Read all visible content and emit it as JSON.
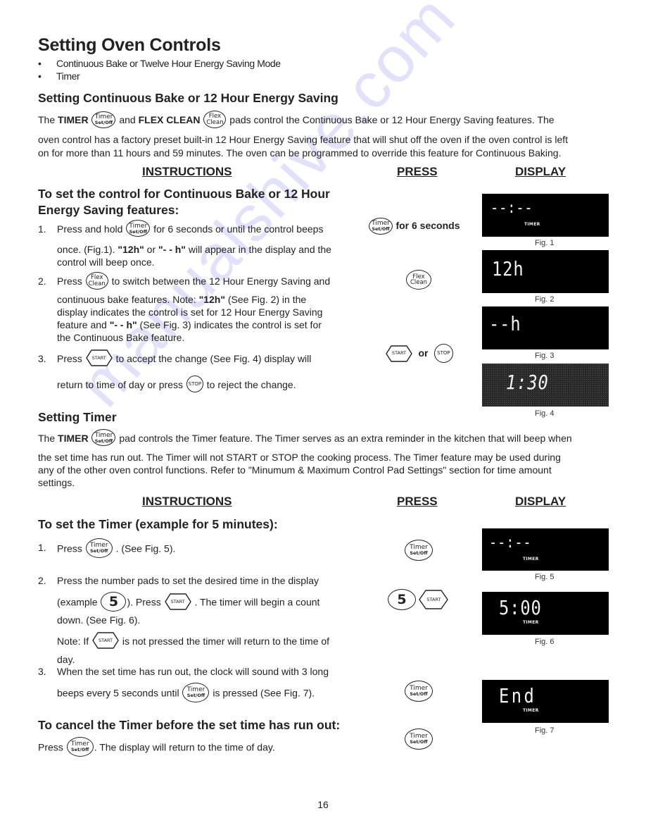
{
  "page": {
    "title": "Setting Oven Controls",
    "bullets": [
      "Continuous Bake or Twelve Hour Energy Saving Mode",
      "Timer"
    ],
    "page_number": "16",
    "watermark": "manualshive.com"
  },
  "pads": {
    "timer": {
      "line1": "Timer",
      "line2": "Set/Off"
    },
    "flex_clean": {
      "line1": "Flex",
      "line2": "Clean"
    },
    "start": "START",
    "stop": "STOP",
    "five": "5"
  },
  "columns": {
    "instructions": "INSTRUCTIONS",
    "press": "PRESS",
    "display": "DISPLAY"
  },
  "section1": {
    "heading": "Setting Continuous Bake or 12 Hour Energy Saving",
    "intro": {
      "p1_a": "The ",
      "p1_timer": "TIMER",
      "p1_b": " and ",
      "p1_flex": "FLEX CLEAN",
      "p1_c": " pads control the Continuous Bake or 12 Hour Energy Saving features. The",
      "line2": "oven control has a factory preset built-in 12 Hour Energy Saving feature that will shut off the oven if the oven control is left",
      "line3": "on for more than 11 hours and 59 minutes. The oven can be programmed to override this feature for Continuous Baking."
    },
    "subheading": "To set the control for Continuous Bake or 12 Hour Energy Saving features:",
    "steps": [
      {
        "num": "1.",
        "a": "Press and hold ",
        "b": " for 6 seconds or until the control beeps",
        "c1": "once.  (Fig.1). ",
        "c_b1": "\"12h\"",
        "c2": " or ",
        "c_b2": "\"- - h\"",
        "c3": "  will appear in the display and the",
        "d": "control will beep once."
      },
      {
        "num": "2.",
        "a": "Press ",
        "b": " to switch between the 12 Hour Energy Saving and",
        "c1": "continuous bake features. Note: ",
        "c_b1": "\"12h\"",
        "c2": " (See Fig. 2) in the",
        "d": "display indicates the control is set for 12 Hour Energy Saving",
        "e1": "feature and ",
        "e_b1": "\"- - h\"",
        "e2": " (See Fig. 3) indicates the control is set for",
        "f": "the Continuous Bake feature."
      },
      {
        "num": "3.",
        "a": "Press ",
        "b": " to accept the change (See Fig. 4) display will",
        "c": "return to time of day or press ",
        "d": " to reject the change."
      }
    ],
    "press": {
      "step1_note": "for 6 seconds",
      "or": "or"
    },
    "figures": [
      {
        "caption": "Fig. 1",
        "readout": "--:--",
        "label": "TIMER"
      },
      {
        "caption": "Fig. 2",
        "readout": "12h",
        "label": ""
      },
      {
        "caption": "Fig. 3",
        "readout": "--h",
        "label": ""
      },
      {
        "caption": "Fig. 4",
        "readout": "1:30",
        "label": ""
      }
    ]
  },
  "section2": {
    "heading": "Setting Timer",
    "intro": {
      "p1_a": "The ",
      "p1_timer": "TIMER",
      "p1_b": " pad controls the Timer feature. The Timer serves as an extra reminder in the kitchen that will beep when",
      "line2": "the set time has run out. The Timer will not START or STOP the cooking process. The Timer feature may be used during",
      "line3": "any of the other oven control functions. Refer to \"Minumum  & Maximum Control Pad Settings\" section for time amount",
      "line4": "settings."
    },
    "subheading": "To set the Timer (example for 5 minutes):",
    "steps": [
      {
        "num": "1.",
        "a": "Press ",
        "b": " . (See Fig. 5)."
      },
      {
        "num": "2.",
        "a": "Press the number pads to set the desired time in the display",
        "b1": "(example ",
        "b2": ").  Press ",
        "b3": " . The timer will begin a count",
        "c": "down. (See Fig. 6).",
        "note_a": "Note: If ",
        "note_b": " is not pressed the timer will return to the time of",
        "note_c": "day."
      },
      {
        "num": "3.",
        "a": "When the set time has run out, the clock will sound with 3 long",
        "b1": "beeps every 5 seconds until ",
        "b2": " is pressed (See Fig. 7)."
      }
    ],
    "cancel_heading": "To cancel the Timer before the set time has run out:",
    "cancel": {
      "a": "Press ",
      "b": ".  The display will return to the time of day."
    },
    "figures": [
      {
        "caption": "Fig. 5",
        "readout": "--:--",
        "label": "TIMER"
      },
      {
        "caption": "Fig. 6",
        "readout": "5:00",
        "label": "TIMER"
      },
      {
        "caption": "Fig. 7",
        "readout": "End",
        "label": "TIMER"
      }
    ]
  }
}
